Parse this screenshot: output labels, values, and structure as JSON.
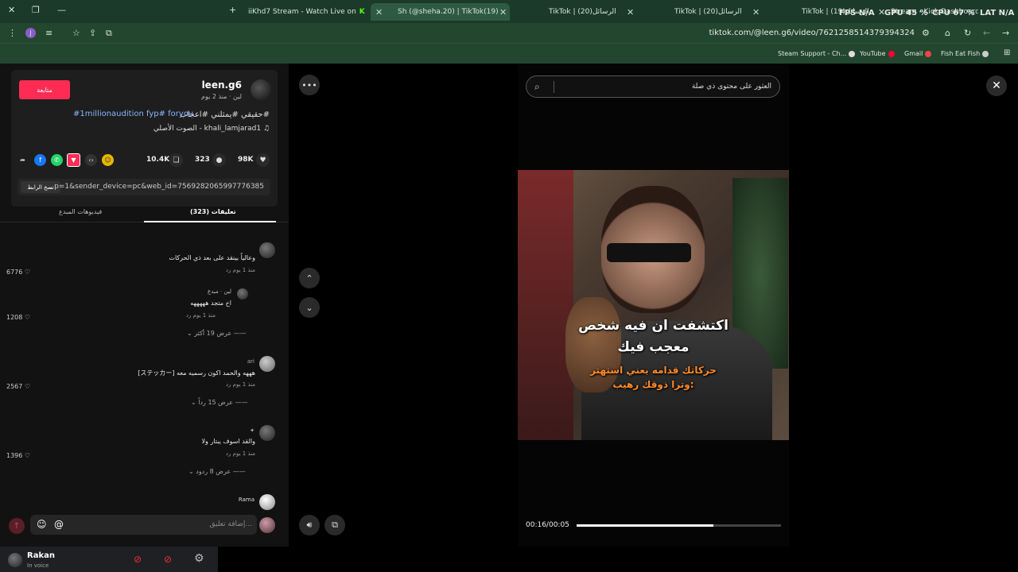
{
  "browser": {
    "tabs": [
      {
        "title": "iiKhd7 Stream - Watch Live on"
      },
      {
        "title": "Sh (@sheha.20) | TikTok(19)"
      },
      {
        "title": "TikTok | (20)الرسائل"
      },
      {
        "title": "TikTok | (20)الرسائل"
      },
      {
        "title": "TikTok | (19)الرسائل"
      },
      {
        "title": "Stream - Kick Dashboard"
      }
    ],
    "overlay": {
      "fps": "FPS N/A",
      "gpu": "GPU 45 %",
      "cpu": "CPU 67 %",
      "lat": "LAT N/A"
    },
    "url": "tiktok.com/@leen.g6/video/7621258514379394324",
    "profile_letter": "J",
    "bookmarks": [
      "Steam Support - Ch...",
      "YouTube",
      "Gmail",
      "Fish Eat Fish"
    ]
  },
  "post": {
    "follow_label": "متابعة",
    "username": "leen.g6",
    "meta": "لين · منذ 2 يوم",
    "caption": "حقيقي #يمثلني #اعجاب#",
    "hashtags": "#1millionaudition fyp# foryou",
    "sound": "الصوت الأصلي - khali_lamjarad1",
    "likes": "98K",
    "comments": "323",
    "saves": "10.4K",
    "link_text": "...p=1&sender_device=pc&web_id=7569282065997776385",
    "copy_label": "نسخ الرابط"
  },
  "tabs": {
    "comments": "(323) تعليقات",
    "creator_videos": "فيديوهات المبدع"
  },
  "comments": [
    {
      "text": "وعالياً بينقد على بعد ذي الحركات",
      "meta": "منذ 1 يوم   رد",
      "likes": "6776"
    },
    {
      "name": "لين · مبدع",
      "text": "اخ متجد هههههه",
      "meta": "منذ 1 يوم   رد",
      "likes": "1208",
      "more": "عرض 19 أكثر"
    },
    {
      "name": "ari",
      "text": "[ステッカー] هههه والحمد اكون رسميه معه",
      "meta": "منذ 1 يوم   رد",
      "likes": "2567",
      "more": "عرض 15 رداً"
    },
    {
      "name": "✦",
      "text": "والقد اسوف يبتار ولا",
      "meta": "منذ 1 يوم   رد",
      "likes": "1396",
      "more": "عرض 8 ردود"
    },
    {
      "name": "Rama"
    }
  ],
  "input": {
    "placeholder": "إضافة تعليق..."
  },
  "video": {
    "search_placeholder": "العثور على محتوى ذي صلة",
    "line1": "اكتشفت ان فيه شخص",
    "line2": "معجب فيك",
    "line3": "حركاتك قدامه يعني استهتر",
    "line4": "وترا ذوقك رهيب:",
    "time": "00:16/00:05",
    "progress": 0.67
  },
  "discord": {
    "user": "Rakan",
    "status": "In voice"
  },
  "colors": {
    "accent": "#fe2c55",
    "tabbar": "#1b3a2a",
    "hashtag": "#8ab4ff"
  }
}
